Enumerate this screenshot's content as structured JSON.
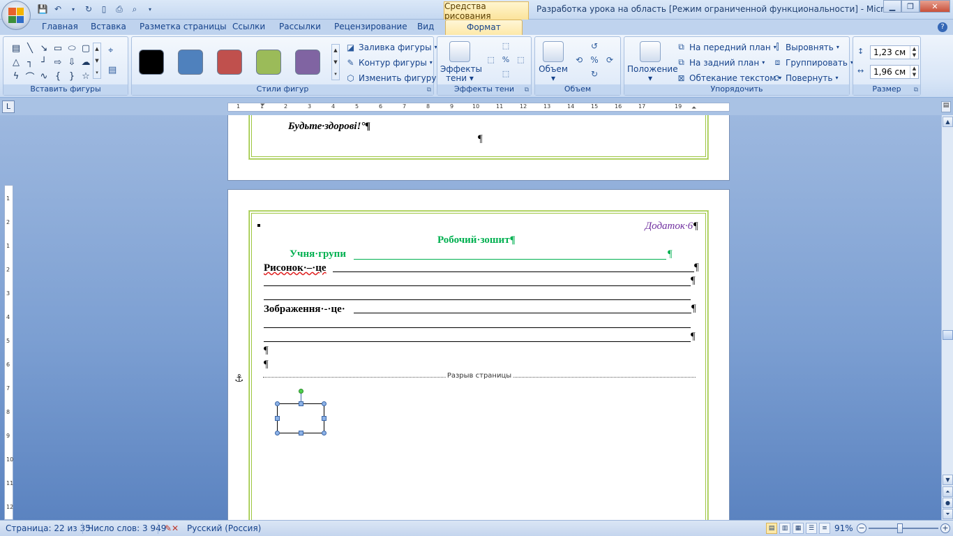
{
  "window": {
    "context_tab": "Средства рисования",
    "title": "Разработка урока на область [Режим ограниченной функциональности] - Microsoft..."
  },
  "tabs": [
    {
      "label": "Главная"
    },
    {
      "label": "Вставка"
    },
    {
      "label": "Разметка страницы"
    },
    {
      "label": "Ссылки"
    },
    {
      "label": "Рассылки"
    },
    {
      "label": "Рецензирование"
    },
    {
      "label": "Вид"
    },
    {
      "label": "Формат"
    }
  ],
  "ribbon": {
    "insert_shapes": {
      "label": "Вставить фигуры"
    },
    "shape_styles": {
      "label": "Стили фигур",
      "swatches": [
        "#000000",
        "#4f81bd",
        "#c0504d",
        "#9bbb59",
        "#8064a2"
      ],
      "fill": "Заливка фигуры",
      "outline": "Контур фигуры",
      "change": "Изменить фигуру"
    },
    "shadow": {
      "label": "Эффекты тени",
      "button_line1": "Эффекты",
      "button_line2": "тени"
    },
    "volume": {
      "label": "Объем",
      "button": "Объем"
    },
    "arrange": {
      "label": "Упорядочить",
      "position": "Положение",
      "bring_front": "На передний план",
      "send_back": "На задний план",
      "wrap": "Обтекание текстом",
      "align": "Выровнять",
      "group": "Группировать",
      "rotate": "Повернуть"
    },
    "size": {
      "label": "Размер",
      "height": "1,23 см",
      "width": "1,96 см"
    }
  },
  "ruler_ticks": [
    "1",
    "1",
    "2",
    "3",
    "4",
    "5",
    "6",
    "7",
    "8",
    "9",
    "10",
    "11",
    "12",
    "13",
    "14",
    "15",
    "16",
    "17",
    "19"
  ],
  "vruler_ticks": [
    "1",
    "2",
    "1",
    "2",
    "3",
    "4",
    "5",
    "6",
    "7",
    "8",
    "9",
    "10",
    "11",
    "12"
  ],
  "document": {
    "farewell": "Будьте·здорові!",
    "farewell_tail": "°¶",
    "pilcrow": "¶",
    "appendix": "Додаток·6",
    "workbook_title": "Робочий·зошит",
    "student_label": "Учня·групи",
    "drawing_is": "Рисонок·–·це",
    "image_is": "Зображення·-·це·",
    "page_break": "Разрыв страницы"
  },
  "status": {
    "page": "Страница: 22 из 35",
    "words": "Число слов: 3 949",
    "language": "Русский (Россия)",
    "zoom": "91%"
  }
}
